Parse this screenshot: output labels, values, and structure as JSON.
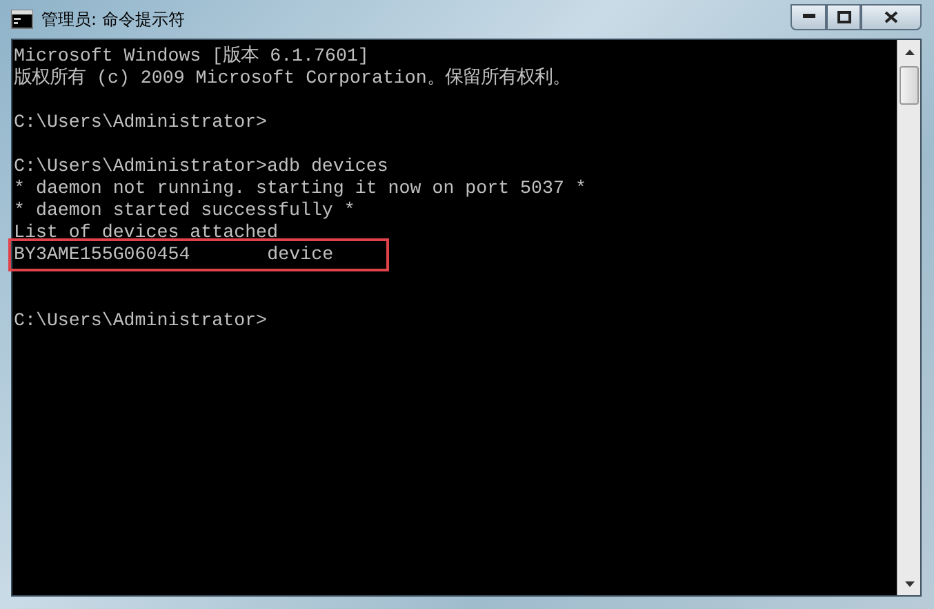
{
  "window": {
    "title": "管理员: 命令提示符"
  },
  "console": {
    "lines": [
      {
        "kind": "text",
        "text": "Microsoft Windows [版本 6.1.7601]"
      },
      {
        "kind": "text",
        "text": "版权所有 (c) 2009 Microsoft Corporation。保留所有权利。"
      },
      {
        "kind": "blank"
      },
      {
        "kind": "text",
        "text": "C:\\Users\\Administrator>"
      },
      {
        "kind": "blank"
      },
      {
        "kind": "text",
        "text": "C:\\Users\\Administrator>adb devices"
      },
      {
        "kind": "text",
        "text": "* daemon not running. starting it now on port 5037 *"
      },
      {
        "kind": "text",
        "text": "* daemon started successfully *"
      },
      {
        "kind": "text",
        "text": "List of devices attached"
      },
      {
        "kind": "device",
        "serial": "BY3AME155G060454",
        "state": "device",
        "highlighted": true
      },
      {
        "kind": "blank"
      },
      {
        "kind": "blank"
      },
      {
        "kind": "text",
        "text": "C:\\Users\\Administrator>"
      }
    ]
  }
}
